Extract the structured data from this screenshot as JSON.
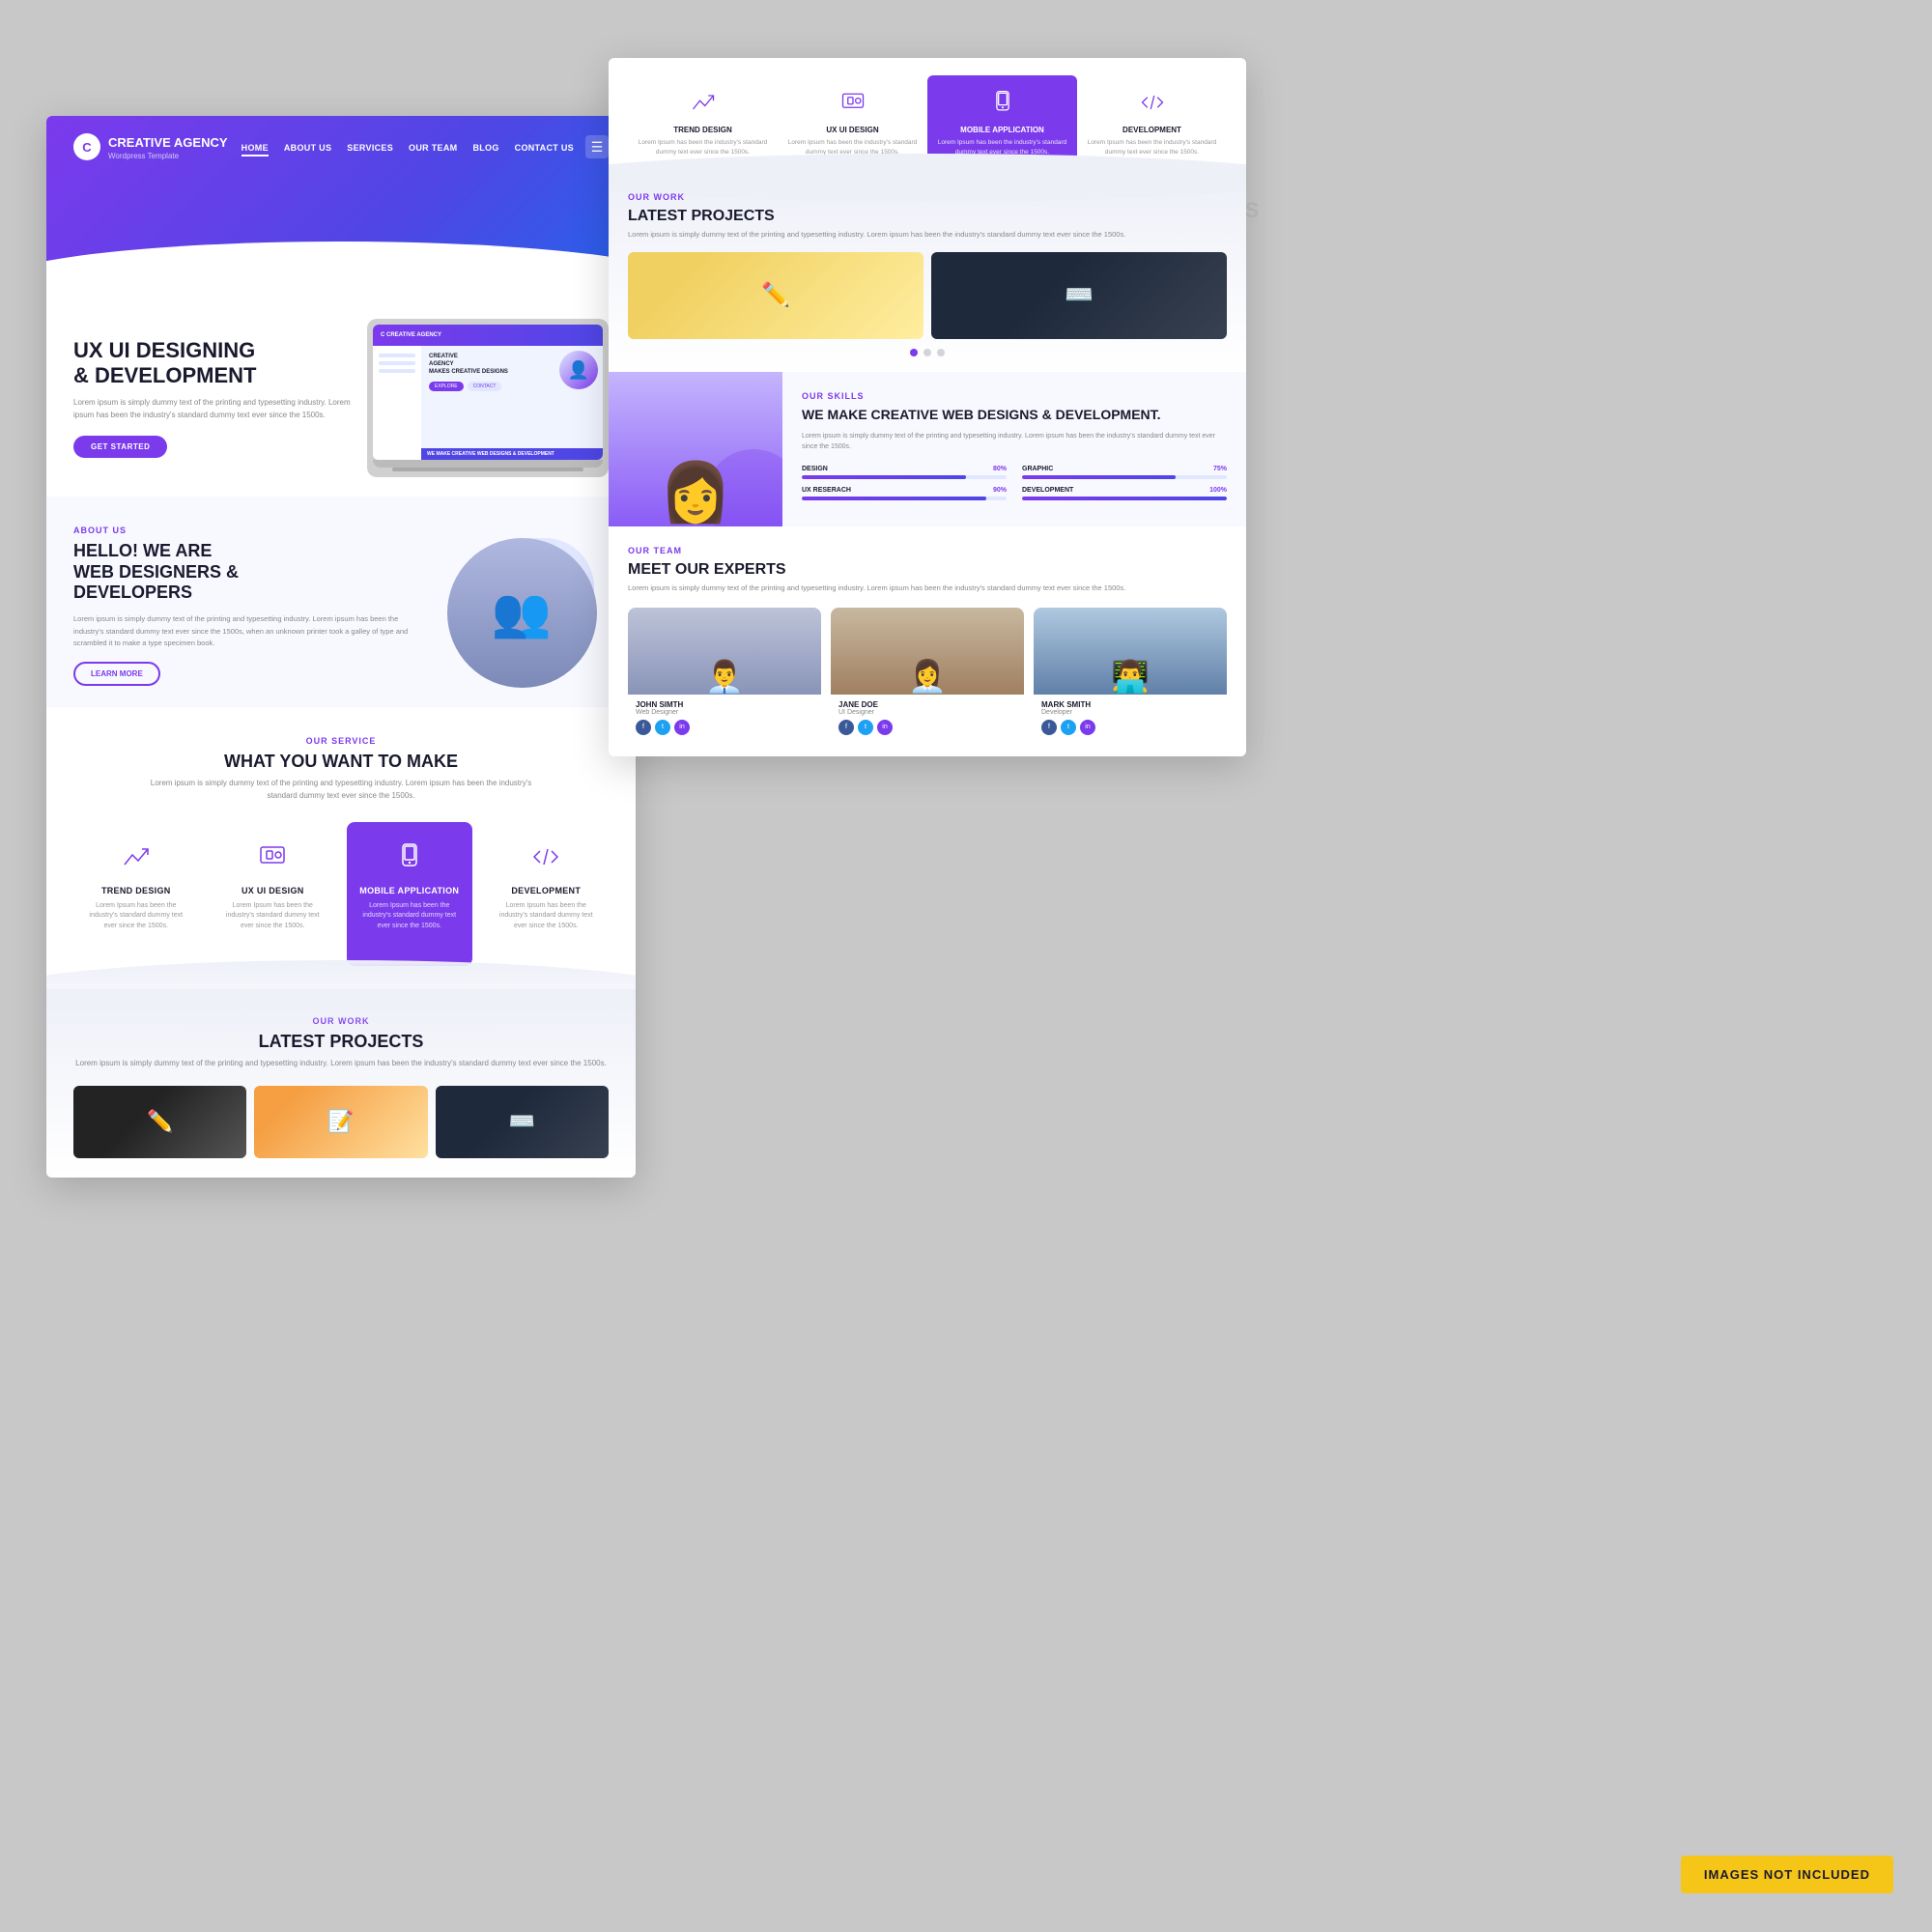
{
  "site": {
    "logo_letter": "C",
    "logo_name": "CREATIVE AGENCY",
    "logo_sub": "Wordpress Template"
  },
  "nav": {
    "links": [
      "HOME",
      "ABOUT US",
      "SERVICES",
      "OUR TEAM",
      "BLOG",
      "CONTACT US"
    ]
  },
  "hero": {
    "title": "UX UI DESIGNING\n& DEVELOPMENT",
    "description": "Lorem ipsum is simply dummy text of the printing and typesetting industry. Lorem ipsum has been the industry's standard dummy text ever since the 1500s.",
    "cta": "GET STARTED"
  },
  "about": {
    "label": "ABOUT US",
    "title": "HELLO! WE ARE\nWEB DESIGNERS &\nDEVELOPERS",
    "description": "Lorem ipsum is simply dummy text of the printing and typesetting industry. Lorem ipsum has been the industry's standard dummy text ever since the 1500s, when an unknown printer took a galley of type and scrambled it to make a type specimen book.",
    "cta": "LEARN MORE"
  },
  "services": {
    "label": "OUR SERVICE",
    "title": "WHAT YOU WANT TO MAKE",
    "description": "Lorem ipsum is simply dummy text of the printing and typesetting industry. Lorem ipsum has been the industry's standard dummy text ever since the 1500s.",
    "items": [
      {
        "icon": "trend-design-icon",
        "name": "TREND DESIGN",
        "desc": "Lorem Ipsum has been the industry's standard dummy text ever since the 1500s."
      },
      {
        "icon": "ux-ui-icon",
        "name": "UX UI DESIGN",
        "desc": "Lorem Ipsum has been the industry's standard dummy text ever since the 1500s."
      },
      {
        "icon": "mobile-app-icon",
        "name": "MOBILE APPLICATION",
        "desc": "Lorem Ipsum has been the industry's standard dummy text ever since the 1500s.",
        "highlight": true
      },
      {
        "icon": "development-icon",
        "name": "DEVELOPMENT",
        "desc": "Lorem Ipsum has been the industry's standard dummy text ever since the 1500s."
      }
    ]
  },
  "projects": {
    "label": "OUR WORK",
    "title": "LATEST PROJECTS",
    "description": "Lorem ipsum is simply dummy text of the printing and typesetting industry. Lorem ipsum has been the industry's standard dummy text ever since the 1500s."
  },
  "skills": {
    "label": "OUR SKILLS",
    "title": "WE MAKE CREATIVE WEB DESIGNS & DEVELOPMENT.",
    "description": "Lorem ipsum is simply dummy text of the printing and typesetting industry. Lorem ipsum has been the industry's standard dummy text ever since the 1500s.",
    "items": [
      {
        "name": "DESIGN",
        "pct": 80
      },
      {
        "name": "GRAPHIC",
        "pct": 75
      },
      {
        "name": "UX RESERACH",
        "pct": 90
      },
      {
        "name": "DEVELOPMENT",
        "pct": 100
      }
    ]
  },
  "team": {
    "label": "OUR TEAM",
    "title": "MEET OUR EXPERTS",
    "description": "Lorem ipsum is simply dummy text of the printing and typesetting industry. Lorem ipsum has been the industry's standard dummy text ever since the 1500s.",
    "members": [
      {
        "name": "JOHN SIMTH",
        "title": "Web Designer"
      },
      {
        "name": "JANE DOE",
        "title": "UI Designer"
      },
      {
        "name": "MARK SMITH",
        "title": "Developer"
      }
    ]
  },
  "badge": {
    "text": "IMAGES NOT INCLUDED"
  },
  "colors": {
    "purple": "#7c3aed",
    "dark_purple": "#4f46e5",
    "dark": "#1a1a2e",
    "gray": "#888"
  }
}
